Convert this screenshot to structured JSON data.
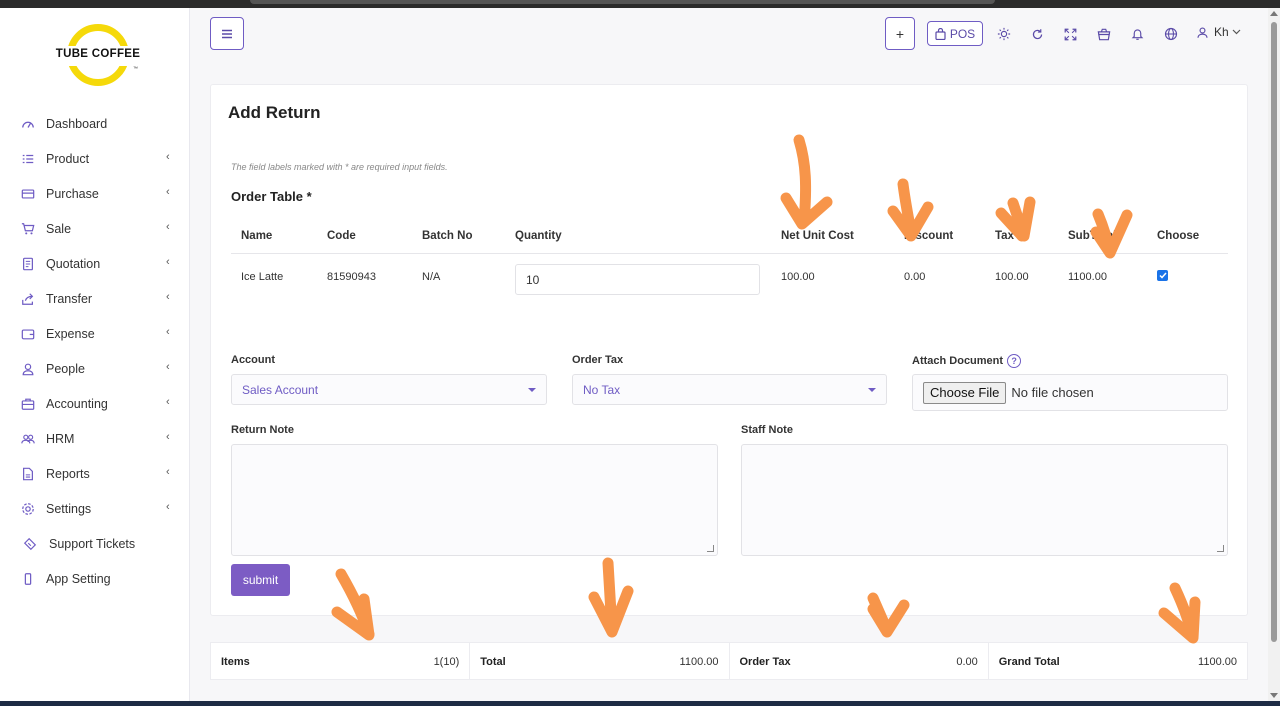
{
  "brand": {
    "name": "TUBE COFFEE",
    "tm": "™"
  },
  "sidebar": {
    "items": [
      {
        "label": "Dashboard",
        "icon": "dashboard-icon",
        "submenu": false
      },
      {
        "label": "Product",
        "icon": "list-icon",
        "submenu": true
      },
      {
        "label": "Purchase",
        "icon": "card-icon",
        "submenu": true
      },
      {
        "label": "Sale",
        "icon": "cart-icon",
        "submenu": true
      },
      {
        "label": "Quotation",
        "icon": "document-icon",
        "submenu": true
      },
      {
        "label": "Transfer",
        "icon": "share-icon",
        "submenu": true
      },
      {
        "label": "Expense",
        "icon": "wallet-icon",
        "submenu": true
      },
      {
        "label": "People",
        "icon": "user-icon",
        "submenu": true
      },
      {
        "label": "Accounting",
        "icon": "briefcase-icon",
        "submenu": true
      },
      {
        "label": "HRM",
        "icon": "users-icon",
        "submenu": true
      },
      {
        "label": "Reports",
        "icon": "file-icon",
        "submenu": true
      },
      {
        "label": "Settings",
        "icon": "gear-icon",
        "submenu": true
      },
      {
        "label": "Support Tickets",
        "icon": "ticket-icon",
        "submenu": false
      },
      {
        "label": "App Setting",
        "icon": "phone-icon",
        "submenu": false
      }
    ]
  },
  "header": {
    "plus_label": "+",
    "pos_label": "POS",
    "user_label": "Kh"
  },
  "form": {
    "title": "Add Return",
    "hint": "The field labels marked with * are required input fields.",
    "order_table_title": "Order Table *",
    "columns": [
      "Name",
      "Code",
      "Batch No",
      "Quantity",
      "Net Unit Cost",
      "Discount",
      "Tax",
      "SubTotal",
      "Choose"
    ],
    "rows": [
      {
        "name": "Ice Latte",
        "code": "81590943",
        "batch": "N/A",
        "quantity": "10",
        "net_unit_cost": "100.00",
        "discount": "0.00",
        "tax": "100.00",
        "subtotal": "1100.00",
        "chosen": true
      }
    ],
    "account_label": "Account",
    "account_value": "Sales Account",
    "order_tax_label": "Order Tax",
    "order_tax_value": "No Tax",
    "attach_label": "Attach Document",
    "file_button": "Choose File",
    "file_status": "No file chosen",
    "return_note_label": "Return Note",
    "staff_note_label": "Staff Note",
    "submit_label": "submit"
  },
  "totals": {
    "items_label": "Items",
    "items_value": "1(10)",
    "total_label": "Total",
    "total_value": "1100.00",
    "order_tax_label": "Order Tax",
    "order_tax_value": "0.00",
    "grand_total_label": "Grand Total",
    "grand_total_value": "1100.00"
  },
  "colors": {
    "accent": "#6f5cc4",
    "annotation": "#f7954a",
    "logo_ring": "#f5d90a"
  }
}
